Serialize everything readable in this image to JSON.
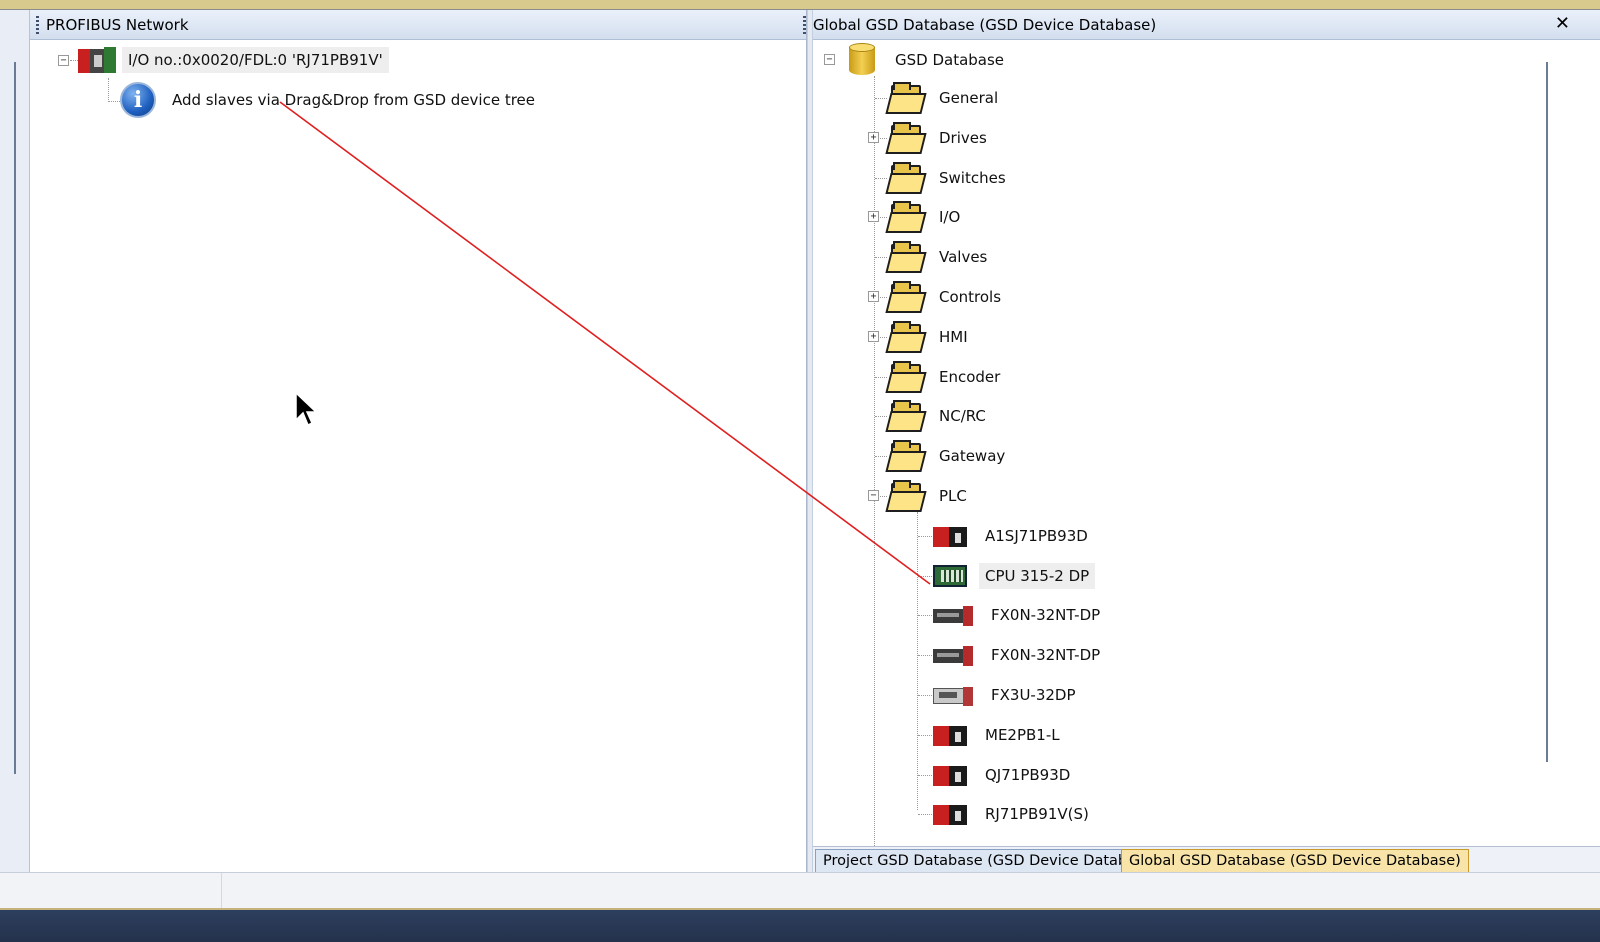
{
  "left_panel": {
    "title": "PROFIBUS Network",
    "master_node": "I/O no.:0x0020/FDL:0 'RJ71PB91V'",
    "info_text": "Add slaves via Drag&Drop from GSD device tree"
  },
  "right_panel": {
    "title": "Global GSD Database (GSD Device Database)",
    "close_glyph": "✕",
    "root": "GSD Database",
    "folders": [
      {
        "label": "General",
        "expandable": false
      },
      {
        "label": "Drives",
        "expandable": true
      },
      {
        "label": "Switches",
        "expandable": false
      },
      {
        "label": "I/O",
        "expandable": true
      },
      {
        "label": "Valves",
        "expandable": false
      },
      {
        "label": "Controls",
        "expandable": true
      },
      {
        "label": "HMI",
        "expandable": true
      },
      {
        "label": "Encoder",
        "expandable": false
      },
      {
        "label": "NC/RC",
        "expandable": false
      },
      {
        "label": "Gateway",
        "expandable": false
      },
      {
        "label": "PLC",
        "expandable": true,
        "expanded": true
      }
    ],
    "plc_devices": [
      {
        "label": "A1SJ71PB93D",
        "icon": "red-module-icon"
      },
      {
        "label": "CPU 315-2 DP",
        "icon": "green-module-icon",
        "selected": true
      },
      {
        "label": "FX0N-32NT-DP",
        "icon": "fx-module-icon"
      },
      {
        "label": "FX0N-32NT-DP",
        "icon": "fx-module-icon"
      },
      {
        "label": "FX3U-32DP",
        "icon": "fx3-module-icon"
      },
      {
        "label": "ME2PB1-L",
        "icon": "red-module-icon"
      },
      {
        "label": "QJ71PB93D",
        "icon": "red-module-icon"
      },
      {
        "label": "RJ71PB91V(S)",
        "icon": "red-module-icon"
      }
    ],
    "tabs": [
      {
        "label": "Project GSD Database (GSD Device Database)",
        "active": false
      },
      {
        "label": "Global GSD Database (GSD Device Database)",
        "active": true
      }
    ]
  },
  "colors": {
    "drag_line": "#e02020",
    "title_gradient_top": "#eaf1fb",
    "active_tab": "#f8e4a8"
  }
}
